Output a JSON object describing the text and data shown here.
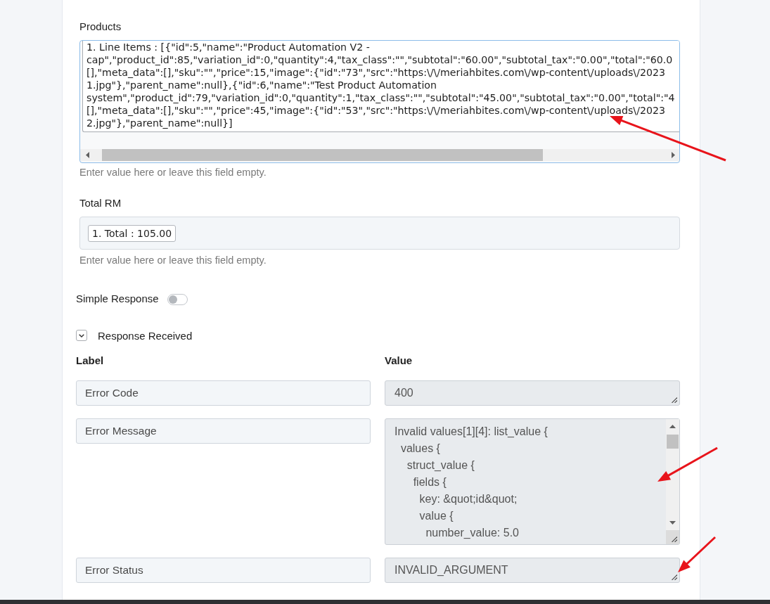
{
  "products": {
    "label": "Products",
    "value": "1. Line Items : [{\"id\":5,\"name\":\"Product Automation V2 -\ncap\",\"product_id\":85,\"variation_id\":0,\"quantity\":4,\"tax_class\":\"\",\"subtotal\":\"60.00\",\"subtotal_tax\":\"0.00\",\"total\":\"60.0\n[],\"meta_data\":[],\"sku\":\"\",\"price\":15,\"image\":{\"id\":\"73\",\"src\":\"https:\\/\\/meriahbites.com\\/wp-content\\/uploads\\/2023\n1.jpg\"},\"parent_name\":null},{\"id\":6,\"name\":\"Test Product Automation\nsystem\",\"product_id\":79,\"variation_id\":0,\"quantity\":1,\"tax_class\":\"\",\"subtotal\":\"45.00\",\"subtotal_tax\":\"0.00\",\"total\":\"4\n[],\"meta_data\":[],\"sku\":\"\",\"price\":45,\"image\":{\"id\":\"53\",\"src\":\"https:\\/\\/meriahbites.com\\/wp-content\\/uploads\\/2023\n2.jpg\"},\"parent_name\":null}]",
    "help_text": "Enter value here or leave this field empty."
  },
  "total": {
    "label": "Total RM",
    "tokens": [
      "1. Total : 105.00"
    ],
    "help_text": "Enter value here or leave this field empty."
  },
  "simple_response": {
    "label": "Simple Response",
    "on": false
  },
  "response_received": {
    "label": "Response Received",
    "expanded": true
  },
  "response_table": {
    "columns": [
      "Label",
      "Value"
    ],
    "rows": [
      {
        "kind": "line",
        "label": "Error Code",
        "value": "400"
      },
      {
        "kind": "scroll",
        "label": "Error Message",
        "value": "Invalid values[1][4]: list_value {\n  values {\n    struct_value {\n      fields {\n        key: &quot;id&quot;\n        value {\n          number_value: 5.0"
      },
      {
        "kind": "line",
        "label": "Error Status",
        "value": "INVALID_ARGUMENT"
      }
    ]
  },
  "annotations": [
    {
      "kind": "arrow"
    },
    {
      "kind": "arrow"
    },
    {
      "kind": "arrow"
    }
  ]
}
